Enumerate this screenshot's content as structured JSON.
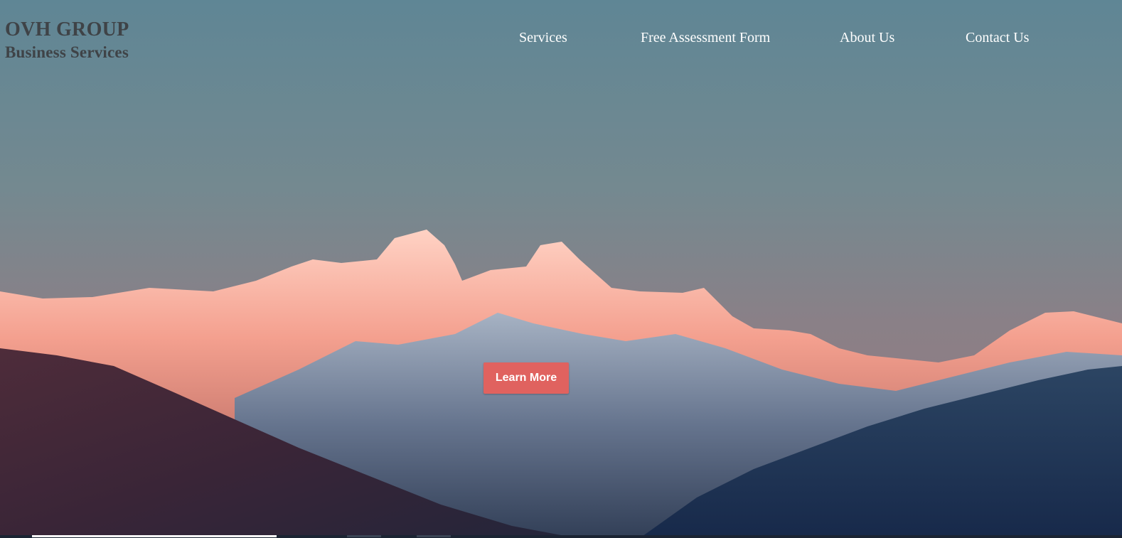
{
  "brand": {
    "name": "OVH GROUP",
    "tagline": "Business Services"
  },
  "nav": {
    "items": [
      {
        "label": "Services"
      },
      {
        "label": "Free Assessment Form"
      },
      {
        "label": "About Us"
      },
      {
        "label": "Contact Us"
      }
    ]
  },
  "hero": {
    "cta_label": "Learn More",
    "background": "mountain-sunset-image"
  },
  "colors": {
    "accent": "#e0625f",
    "nav_text": "#ffffff",
    "brand_text": "#3f4347",
    "sky_top": "#5e8494",
    "sky_horizon": "#8a7f86"
  }
}
